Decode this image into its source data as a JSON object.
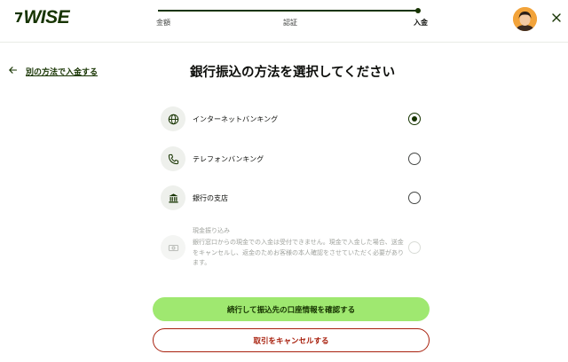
{
  "brand": {
    "logo_mark": "7",
    "logo_text": "WISE",
    "primary": "#9fe870",
    "forest": "#163300",
    "danger": "#a8200d"
  },
  "stepper": {
    "steps": [
      "金額",
      "認証",
      "入金"
    ],
    "current": 3,
    "progress": 1.0
  },
  "nav": {
    "back_label": "別の方法で入金する",
    "close_icon": "close-icon",
    "avatar_icon": "avatar"
  },
  "main": {
    "title": "銀行振込の方法を選択してください",
    "options": [
      {
        "label": "インターネットバンキング",
        "icon": "globe-icon",
        "selected": true
      },
      {
        "label": "テレフォンバンキング",
        "icon": "phone-icon",
        "selected": false
      },
      {
        "label": "銀行の支店",
        "icon": "bank-icon",
        "selected": false
      },
      {
        "label": "現金振り込み",
        "icon": "cash-icon",
        "selected": false,
        "disabled": true,
        "description": "銀行窓口からの現金での入金は受付できません。現金で入金した場合、送金をキャンセルし、返金のためお客様の本人確認をさせていただく必要があります。"
      }
    ],
    "primary_button": "続行して振込先の口座情報を確認する",
    "cancel_button": "取引をキャンセルする"
  }
}
